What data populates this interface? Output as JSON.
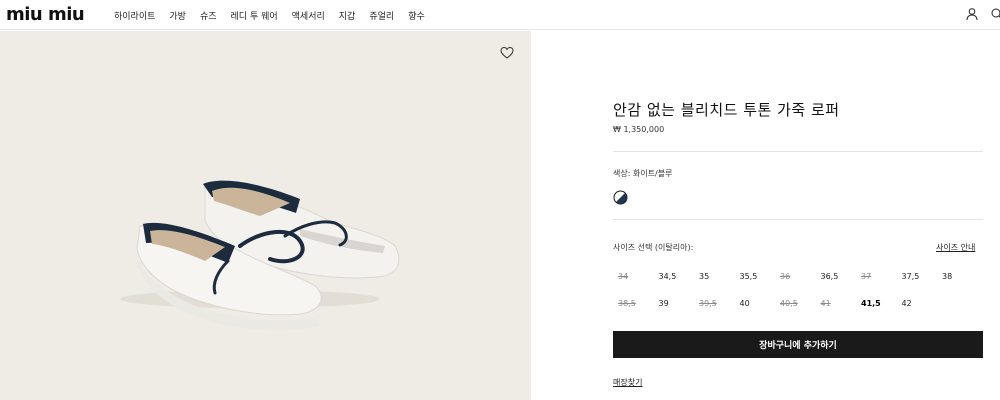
{
  "brand": {
    "logo_text": "miu miu"
  },
  "nav": {
    "items": [
      "하이라이트",
      "가방",
      "슈즈",
      "레디 투 웨어",
      "액세서리",
      "지갑",
      "쥬얼리",
      "향수"
    ]
  },
  "header_icons": [
    "user-icon",
    "search-icon"
  ],
  "gallery": {
    "wishlist_icon": "heart-icon",
    "background": "#efebe5"
  },
  "product": {
    "title": "안감 없는 블리치드 투톤 가죽 로퍼",
    "price": "₩ 1,350,000",
    "color_label": "색상:",
    "color_value": "화이트/블루",
    "swatch_colors": [
      "#ffffff",
      "#1f3550"
    ],
    "size_label": "사이즈 선택 (이탈리아):",
    "size_guide": "사이즈 안내",
    "sizes": [
      {
        "label": "34",
        "available": false
      },
      {
        "label": "34,5",
        "available": true
      },
      {
        "label": "35",
        "available": true
      },
      {
        "label": "35,5",
        "available": true
      },
      {
        "label": "36",
        "available": false
      },
      {
        "label": "36,5",
        "available": true
      },
      {
        "label": "37",
        "available": false
      },
      {
        "label": "37,5",
        "available": true
      },
      {
        "label": "38",
        "available": true
      },
      {
        "label": "38,5",
        "available": false
      },
      {
        "label": "39",
        "available": true
      },
      {
        "label": "39,5",
        "available": false
      },
      {
        "label": "40",
        "available": true
      },
      {
        "label": "40,5",
        "available": false
      },
      {
        "label": "41",
        "available": false
      },
      {
        "label": "41,5",
        "available": true,
        "selected": true
      },
      {
        "label": "42",
        "available": true
      }
    ],
    "add_to_cart": "장바구니에 추가하기",
    "store_locator": "매장찾기"
  }
}
